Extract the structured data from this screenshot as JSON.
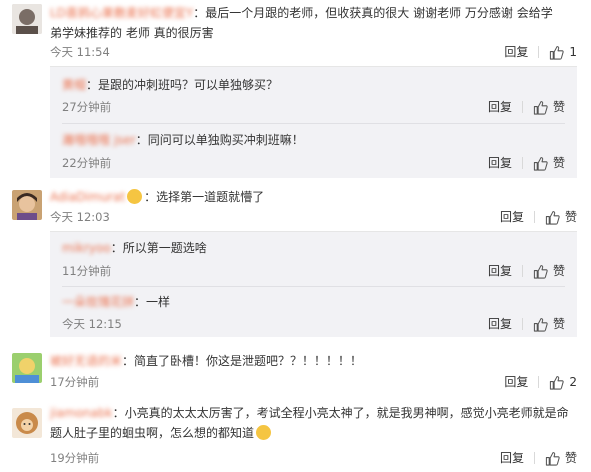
{
  "actions": {
    "reply": "回复",
    "like": "赞"
  },
  "comments": [
    {
      "user": "LD喜鸦心果敷麦好虹便宜Y",
      "text_a": "：最后一个月跟的老师，但收获真的很大  谢谢老师  万分感谢  会给学",
      "text_b": "弟学妹推荐的  老师  真的很厉害",
      "time": "今天 11:54",
      "likes": "1",
      "replies": [
        {
          "user": "黄帽",
          "text": "：是跟的冲刺班吗？可以单独够买？",
          "time": "27分钟前"
        },
        {
          "user": "灕哦哦哦 jser",
          "text": "：同问可以单独购买冲刺班嘛！",
          "time": "22分钟前"
        }
      ]
    },
    {
      "user": "AdiaDimurat",
      "text": "：选择第一道题就懵了",
      "time": "今天 12:03",
      "likes": "",
      "replies": [
        {
          "user": "mikryoo",
          "text": "：所以第一题选啥",
          "time": "11分钟前"
        },
        {
          "user": "一朵玫瑰花拼",
          "text": "：一样",
          "time": "今天 12:15"
        }
      ]
    },
    {
      "user": "被好无语的米",
      "text": "：简直了卧槽！你这是泄题吧？？！！！！！",
      "time": "17分钟前",
      "likes": "2"
    },
    {
      "user": "jiamonabk",
      "text_a": "：小亮真的太太太厉害了，考试全程小亮太神了，就是我男神啊，感觉小亮老师就是命",
      "text_b": "题人肚子里的蛔虫啊，怎么想的都知道",
      "time": "19分钟前",
      "likes": ""
    }
  ],
  "colors": {
    "username": "#eb7350",
    "reply_bg": "#f2f2f5"
  }
}
